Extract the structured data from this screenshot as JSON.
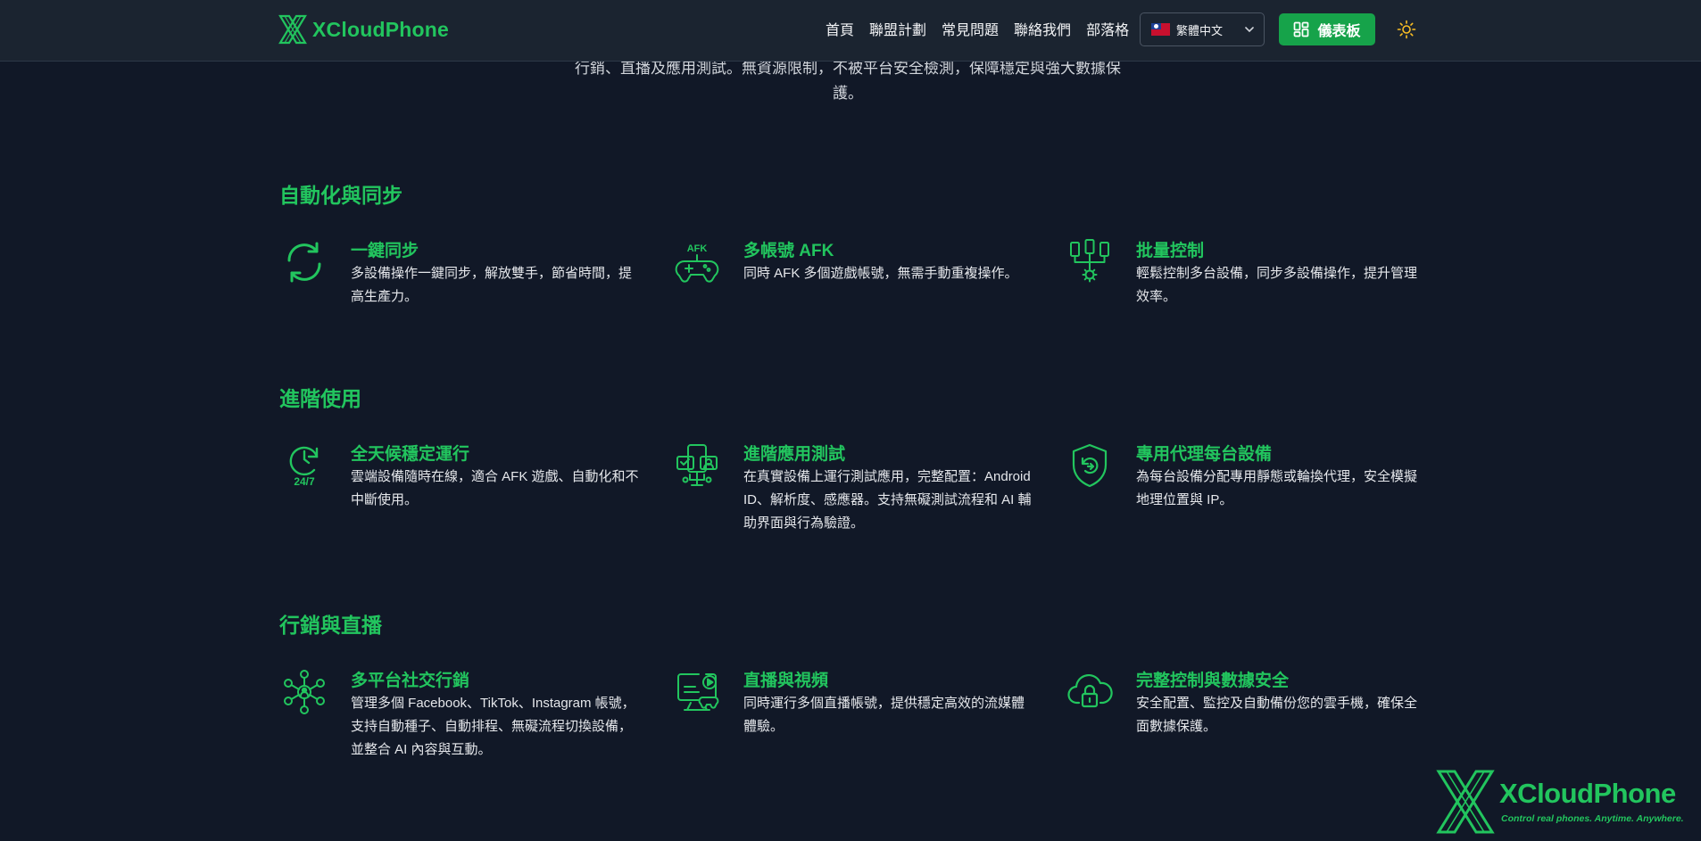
{
  "header": {
    "brand": "XCloudPhone",
    "nav": [
      "首頁",
      "聯盟計劃",
      "常見問題",
      "聯絡我們",
      "部落格"
    ],
    "language": "繁體中文",
    "dashboard_label": "儀表板"
  },
  "intro": {
    "line1": "行銷、直播及應用測試。無資源限制，不被平台安全檢測，保障穩定與強大數據保",
    "line2": "護。"
  },
  "sections": [
    {
      "title": "自動化與同步",
      "features": [
        {
          "icon": "sync-icon",
          "title": "一鍵同步",
          "desc": "多設備操作一鍵同步，解放雙手，節省時間，提高生產力。"
        },
        {
          "icon": "afk-gamepad-icon",
          "icon_text": "AFK",
          "title": "多帳號 AFK",
          "desc": "同時 AFK 多個遊戲帳號，無需手動重複操作。"
        },
        {
          "icon": "batch-control-icon",
          "title": "批量控制",
          "desc": "輕鬆控制多台設備，同步多設備操作，提升管理效率。"
        }
      ]
    },
    {
      "title": "進階使用",
      "features": [
        {
          "icon": "clock-24-7-icon",
          "icon_text": "24/7",
          "title": "全天候穩定運行",
          "desc": "雲端設備隨時在線，適合 AFK 遊戲、自動化和不中斷使用。"
        },
        {
          "icon": "app-testing-icon",
          "title": "進階應用測試",
          "desc": "在真實設備上運行測試應用，完整配置：Android ID、解析度、感應器。支持無礙測試流程和 AI 輔助界面與行為驗證。"
        },
        {
          "icon": "proxy-shield-icon",
          "title": "專用代理每台設備",
          "desc": "為每台設備分配專用靜態或輪換代理，安全模擬地理位置與 IP。"
        }
      ]
    },
    {
      "title": "行銷與直播",
      "features": [
        {
          "icon": "social-network-icon",
          "title": "多平台社交行銷",
          "desc": "管理多個 Facebook、TikTok、Instagram 帳號，支持自動種子、自動排程、無礙流程切換設備，並整合 AI 內容與互動。"
        },
        {
          "icon": "livestream-icon",
          "title": "直播與視頻",
          "desc": "同時運行多個直播帳號，提供穩定高效的流媒體體驗。"
        },
        {
          "icon": "cloud-lock-icon",
          "title": "完整控制與數據安全",
          "desc": "安全配置、監控及自動備份您的雲手機，確保全面數據保護。"
        }
      ]
    }
  ],
  "corner_logo": {
    "name": "XCloudPhone",
    "tagline": "Control real phones. Anytime. Anywhere."
  },
  "colors": {
    "background": "#111827",
    "header_bg": "#1b2430",
    "accent_green": "#22c55e",
    "button_green": "#16a34a"
  }
}
